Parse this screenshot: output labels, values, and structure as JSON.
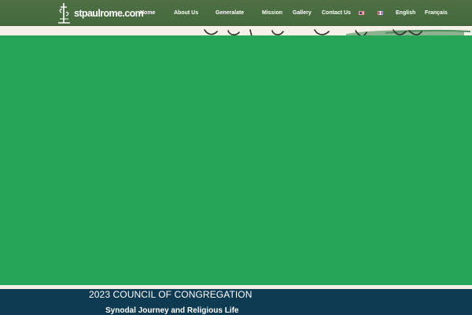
{
  "header": {
    "logo_text": "stpaulrome.com",
    "nav": [
      {
        "label": "Home"
      },
      {
        "label": "About Us"
      },
      {
        "label": "Generalate"
      },
      {
        "label": "Mission"
      },
      {
        "label": "Gallery"
      },
      {
        "label": "Contact Us"
      }
    ],
    "languages": {
      "english": "English",
      "francais": "Français"
    }
  },
  "hero": {
    "color": "#27a557"
  },
  "band": {
    "title": "2023 COUNCIL OF CONGREGATION",
    "subtitle": "Synodal Journey and Religious Life",
    "color": "#0e3b52"
  },
  "colors": {
    "header": "#4a6c41",
    "cream": "#f3efe6"
  }
}
